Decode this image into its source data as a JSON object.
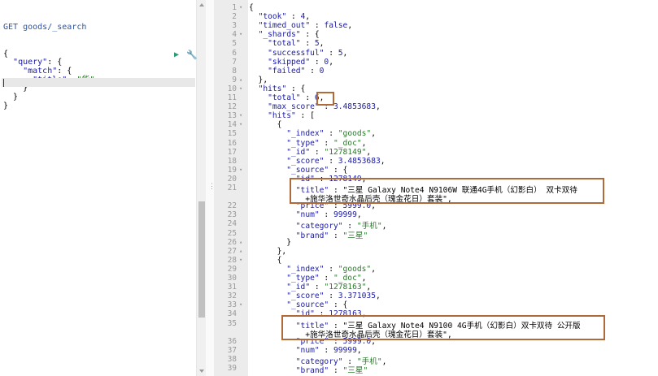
{
  "request": {
    "method": "GET",
    "path": "goods/_search",
    "lines": [
      "{",
      "  \"query\": {",
      "    \"match\": {",
      "      \"title\": \"华\"",
      "    }",
      "  }",
      "}"
    ]
  },
  "icons": {
    "run": "play-icon",
    "settings": "wrench-icon",
    "resize": "drag-handle-icon"
  },
  "response": {
    "line_numbers": [
      "1",
      "2",
      "3",
      "4",
      "5",
      "6",
      "7",
      "8",
      "9",
      "10",
      "11",
      "12",
      "13",
      "14",
      "15",
      "16",
      "17",
      "18",
      "19",
      "20",
      "21",
      "",
      "22",
      "23",
      "24",
      "25",
      "26",
      "27",
      "28",
      "29",
      "30",
      "31",
      "32",
      "33",
      "34",
      "35",
      "",
      "36",
      "37",
      "38",
      "39"
    ],
    "lines": [
      "{",
      "  \"took\" : 4,",
      "  \"timed_out\" : false,",
      "  \"_shards\" : {",
      "    \"total\" : 5,",
      "    \"successful\" : 5,",
      "    \"skipped\" : 0,",
      "    \"failed\" : 0",
      "  },",
      "  \"hits\" : {",
      "    \"total\" : 6,",
      "    \"max_score\" : 3.4853683,",
      "    \"hits\" : [",
      "      {",
      "        \"_index\" : \"goods\",",
      "        \"_type\" : \"_doc\",",
      "        \"_id\" : \"1278149\",",
      "        \"_score\" : 3.4853683,",
      "        \"_source\" : {",
      "          \"id\" : 1278149,",
      "          \"title\" : \"三星 Galaxy Note4 N9106W 联通4G手机（幻影白） 双卡双待",
      "            +施华洛世奇水晶后壳（瑰金花日）套装\",",
      "          \"price\" : 5999.0,",
      "          \"num\" : 99999,",
      "          \"category\" : \"手机\",",
      "          \"brand\" : \"三星\"",
      "        }",
      "      },",
      "      {",
      "        \"_index\" : \"goods\",",
      "        \"_type\" : \"_doc\",",
      "        \"_id\" : \"1278163\",",
      "        \"_score\" : 3.371035,",
      "        \"_source\" : {",
      "          \"id\" : 1278163,",
      "          \"title\" : \"三星 Galaxy Note4 N9100 4G手机（幻影白）双卡双待 公开版",
      "            +施华洛世奇水晶后壳（瑰金花日）套装\",",
      "          \"price\" : 5999.0,",
      "          \"num\" : 99999,",
      "          \"category\" : \"手机\",",
      "          \"brand\" : \"三星\""
    ]
  }
}
